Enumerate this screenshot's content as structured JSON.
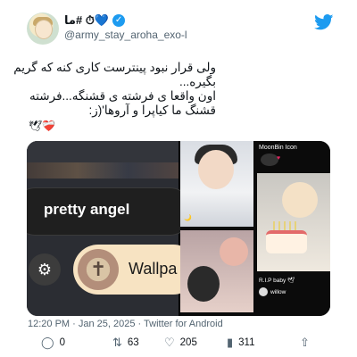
{
  "header": {
    "display_name": "ما# ⏱💙",
    "handle": "@army_stay_aroha_exo-l",
    "verified": true
  },
  "tweet": {
    "lines": [
      "ولی قرار نبود پینترست کاری کنه که گریم",
      "بگیره...",
      "اون واقعا ی فرشته ی قشنگه...فرشته",
      "قشنگ ما کیاپرا و آروها'(ز:"
    ],
    "emojis": "🕊❤‍🩹"
  },
  "media": {
    "left": {
      "label": "pretty angel",
      "button": "Wallpa"
    },
    "right": {
      "moon_label": "MoonBin Icon",
      "rip_label": "R.I.P baby 🕊",
      "willow_label": "willow"
    }
  },
  "meta": {
    "time": "12:20 PM · Jan 25, 2025 · Twitter for Android"
  },
  "actions": {
    "replies": "0",
    "retweets": "63",
    "likes": "205",
    "views": "311"
  },
  "colors": {
    "accent": "#1d9bf0",
    "text": "#0f1419",
    "muted": "#536471"
  }
}
